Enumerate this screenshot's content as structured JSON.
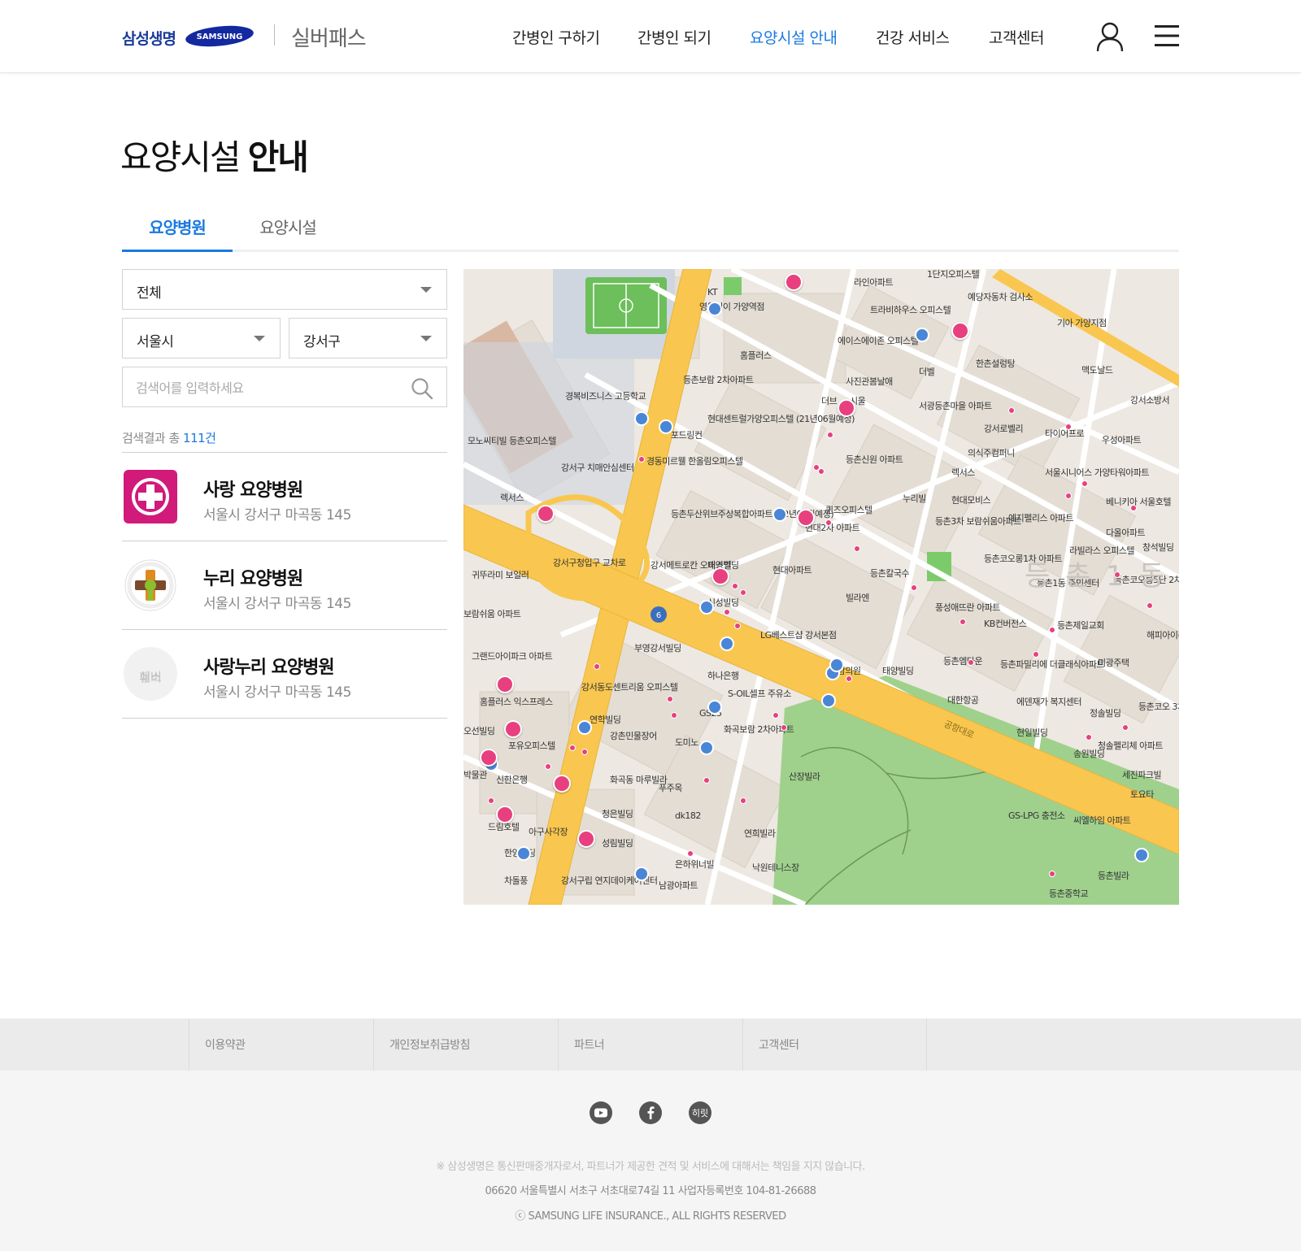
{
  "header": {
    "brand_kr": "삼성생명",
    "brand_en": "SAMSUNG",
    "service_name": "실버패스",
    "nav": [
      {
        "label": "간병인 구하기"
      },
      {
        "label": "간병인 되기"
      },
      {
        "label": "요양시설 안내"
      },
      {
        "label": "건강 서비스"
      },
      {
        "label": "고객센터"
      }
    ],
    "active_nav": "요양시설 안내",
    "accent_color": "#1a79e0",
    "icons": [
      "user-icon",
      "hamburger-menu-icon"
    ]
  },
  "page": {
    "title_light": "요양시설",
    "title_bold": "안내"
  },
  "tabs": [
    {
      "label": "요양병원",
      "active": true
    },
    {
      "label": "요양시설",
      "active": false
    }
  ],
  "filters": {
    "type_select": "전체",
    "city_select": "서울시",
    "district_select": "강서구",
    "search_placeholder": "검색어를 입력하세요"
  },
  "results": {
    "prefix": "검색결과 총 ",
    "count": "111건",
    "items": [
      {
        "name": "사랑 요양병원",
        "address": "서울시 강서구 마곡동 145",
        "thumb": "hospital-cross-logo"
      },
      {
        "name": "누리 요양병원",
        "address": "서울시 강서구 마곡동 145",
        "thumb": "nuri-emblem-logo"
      },
      {
        "name": "사랑누리 요양병원",
        "address": "서울시 강서구 마곡동 145",
        "thumb": "silverpass-placeholder",
        "thumb_text_1": "실버",
        "thumb_text_2": "패스"
      }
    ]
  },
  "map": {
    "labels": [
      "라인아파트",
      "1단지오피스텔",
      "KT",
      "영웅인이 가양역점",
      "트라비하우스 오피스텔",
      "예당자동차 검사소",
      "기아 가양지점",
      "홈플러스",
      "에이스에이존 오피스텔",
      "한촌설렁탕",
      "맥도날드",
      "사진관봄날애",
      "더벨",
      "등촌보람 2차아파트",
      "경복비즈니스 고등학교",
      "더브",
      "시울",
      "서광등촌마을 아파트",
      "강서소방서",
      "현대센트럴가양오피스텔 (21년06월예정)",
      "포드링컨",
      "강서로벨리",
      "타이어프로",
      "우성아파트",
      "모노씨티빌 등촌오피스텔",
      "경동미르웰 한올림오피스텔",
      "의식주컴퍼니",
      "강서구 치매안심센터",
      "등촌신원 아파트",
      "렉서스",
      "서울시니어스 가양타워아파트",
      "누리빌",
      "현대모비스",
      "렉서스",
      "등촌두산위브주상복합아파트 (22년03월예정)",
      "퀸즈오피스텔",
      "베니키아 서울호텔",
      "현대2차 아파트",
      "등촌3차 보람쉬움아파트",
      "예지펠리스 아파트",
      "다올아파트",
      "창석빌딩",
      "라빌라스 오피스텔",
      "강서구청입구 교차로",
      "강서메트로칸 오피스텔",
      "태영빌딩",
      "현대아파트",
      "등촌칼국수",
      "등촌코오롱1차 아파트",
      "귀뚜라미 보일러",
      "등촌1동 주민센터",
      "등촌코오롱5단 2차아파트",
      "빌라엔",
      "신성빌딩",
      "풍성애뜨란 아파트",
      "KB컨버전스",
      "등촌제일교회",
      "해피아이리",
      "보람쉬움 아파트",
      "LG베스트샵 강서본점",
      "부영강서빌딩",
      "그랜드아이파크 아파트",
      "등촌엠타운",
      "등촌파밀리에 더클래식아파트",
      "미광주택",
      "하나은행",
      "보람의원",
      "태양빌딩",
      "강서동도센트리움 오피스텔",
      "S-OIL셀프 주유소",
      "대한항공",
      "에덴재가 복지센터",
      "홈플러스 익스프레스",
      "GS25",
      "정솔빌딩",
      "등촌코오 3차아",
      "연학빌딩",
      "강촌민물장어",
      "도미노",
      "화곡보람 2차아파트",
      "현일빌딩",
      "청솔펠리체 아파트",
      "오선빌딩",
      "포유오피스텔",
      "송원빌딩",
      "세진파크빌",
      "박물관",
      "신한은행",
      "화곡동 마루빌라",
      "푸주옥",
      "산장빌라",
      "토요타",
      "드림호텔",
      "청은빌딩",
      "dk182",
      "GS-LPG 충전소",
      "씨엘하임 아파트",
      "아구사각장",
      "성림빌딩",
      "연희빌라",
      "한양빌딩",
      "은하위너빌",
      "낙원테니스장",
      "등촌빌라",
      "차돌풍",
      "강서구립 연지데이케어센터",
      "남광아파트",
      "등촌중학교",
      "공항대로",
      "등 촌 1 동"
    ],
    "road_color": "#f9c74f",
    "park_color": "#9fd18d",
    "poi_color": "#e8407f"
  },
  "footer": {
    "links": [
      {
        "label": "이용약관"
      },
      {
        "label": "개인정보취급방침"
      },
      {
        "label": "파트너"
      },
      {
        "label": "고객센터"
      }
    ],
    "sns": [
      "youtube-icon",
      "facebook-icon",
      "hiret-icon"
    ],
    "hiret_label": "히릿",
    "disclaimer": "※ 삼성생명은 통신판매중개자로서, 파트너가 제공한 견적 및 서비스에 대해서는 책임을 지지 않습니다.",
    "address": "06620 서울특별시 서초구 서초대로74길 11    사업자등록번호 104-81-26688",
    "copyright": "ⓒ SAMSUNG LIFE INSURANCE., ALL RIGHTS RESERVED"
  }
}
